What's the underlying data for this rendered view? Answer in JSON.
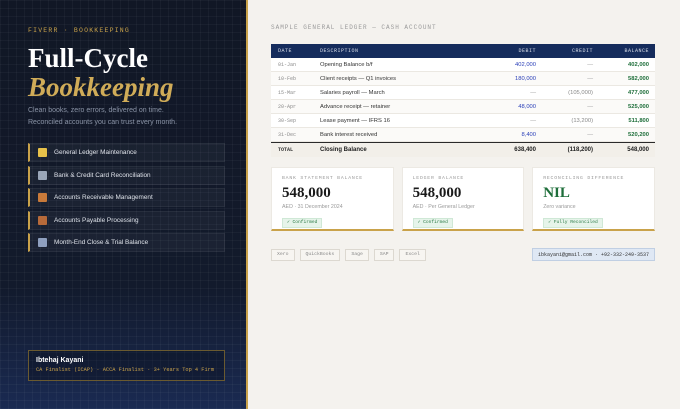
{
  "left": {
    "eyebrow": "FIVERR · BOOKKEEPING",
    "title_line1": "Full-Cycle",
    "title_line2": "Bookkeeping",
    "tagline_line1": "Clean books, zero errors, delivered on time.",
    "tagline_line2": "Reconciled accounts you can trust every month.",
    "services": [
      {
        "label": "General Ledger Maintenance",
        "icon": "ledger-icon"
      },
      {
        "label": "Bank & Credit Card Reconciliation",
        "icon": "bank-icon"
      },
      {
        "label": "Accounts Receivable Management",
        "icon": "receivable-icon"
      },
      {
        "label": "Accounts Payable Processing",
        "icon": "payable-icon"
      },
      {
        "label": "Month-End Close & Trial Balance",
        "icon": "chart-icon"
      }
    ],
    "profile": {
      "name": "Ibtehaj Kayani",
      "credentials": "CA Finalist (ICAP) · ACCA Finalist · 3+ Years Top 4 Firm"
    }
  },
  "ledger": {
    "section_title": "SAMPLE GENERAL LEDGER — CASH ACCOUNT",
    "headers": {
      "date": "DATE",
      "description": "DESCRIPTION",
      "debit": "DEBIT",
      "credit": "CREDIT",
      "balance": "BALANCE"
    },
    "rows": [
      {
        "date": "01-Jan",
        "description": "Opening Balance b/f",
        "debit": "402,000",
        "credit": "—",
        "balance": "402,000"
      },
      {
        "date": "10-Feb",
        "description": "Client receipts — Q1 invoices",
        "debit": "180,000",
        "credit": "—",
        "balance": "582,000"
      },
      {
        "date": "15-Mar",
        "description": "Salaries payroll — March",
        "debit": "—",
        "credit": "(105,000)",
        "balance": "477,000"
      },
      {
        "date": "20-Apr",
        "description": "Advance receipt — retainer",
        "debit": "48,000",
        "credit": "—",
        "balance": "525,000"
      },
      {
        "date": "30-Sep",
        "description": "Lease payment — IFRS 16",
        "debit": "—",
        "credit": "(13,200)",
        "balance": "511,800"
      },
      {
        "date": "31-Dec",
        "description": "Bank interest received",
        "debit": "8,400",
        "credit": "—",
        "balance": "520,200"
      }
    ],
    "total": {
      "label": "TOTAL",
      "description": "Closing Balance",
      "debit": "638,400",
      "credit": "(118,200)",
      "balance": "548,000"
    }
  },
  "cards": [
    {
      "label": "BANK STATEMENT BALANCE",
      "value": "548,000",
      "sub": "AED · 31 December 2024",
      "badge": "✓ Confirmed"
    },
    {
      "label": "LEDGER BALANCE",
      "value": "548,000",
      "sub": "AED · Per General Ledger",
      "badge": "✓ Confirmed"
    },
    {
      "label": "RECONCILING DIFFERENCE",
      "value": "NIL",
      "sub": "Zero variance",
      "badge": "✓ Fully Reconciled"
    }
  ],
  "footer": {
    "tools": [
      "Xero",
      "QuickBooks",
      "Sage",
      "SAP",
      "Excel"
    ],
    "contact": "ibkayani@gmail.com · +92-332-249-3537"
  }
}
